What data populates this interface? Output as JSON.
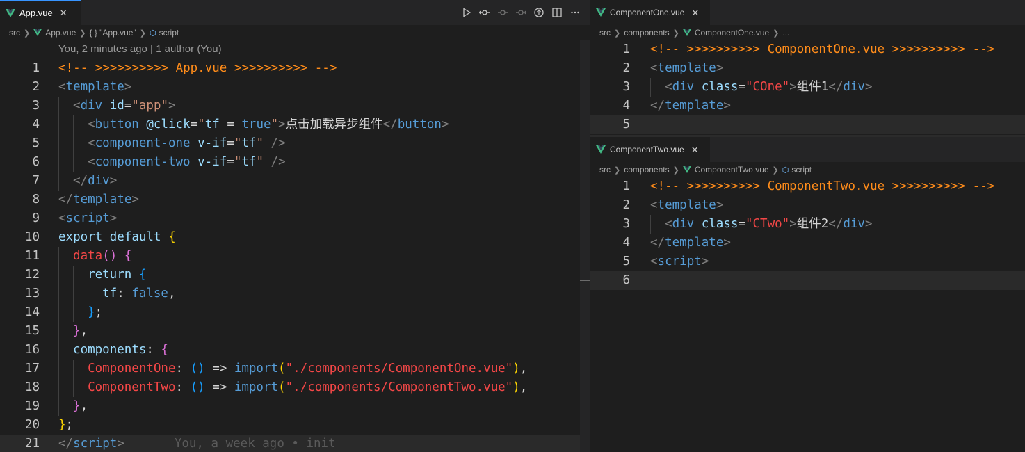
{
  "left": {
    "tab_label": "App.vue",
    "breadcrumb": [
      "src",
      "App.vue",
      "{ } \"App.vue\"",
      "script"
    ],
    "codelens": "You, 2 minutes ago | 1 author (You)",
    "blame": "You, a week ago • init",
    "line_numbers": [
      "1",
      "2",
      "3",
      "4",
      "5",
      "6",
      "7",
      "8",
      "9",
      "10",
      "11",
      "12",
      "13",
      "14",
      "15",
      "16",
      "17",
      "18",
      "19",
      "20",
      "21"
    ],
    "lines": [
      [
        "<!-- >>>>>>>>>> App.vue >>>>>>>>>> -->"
      ],
      [
        "<",
        "template",
        ">"
      ],
      [
        "<",
        "div",
        " ",
        "id",
        "=",
        "\"app\"",
        ">"
      ],
      [
        "<",
        "button",
        " ",
        "@click",
        "=",
        "\"",
        "tf",
        " = ",
        "true",
        "\"",
        ">",
        "点击加载异步组件",
        "</",
        "button",
        ">"
      ],
      [
        "<",
        "component-one",
        " ",
        "v-if",
        "=",
        "\"",
        "tf",
        "\"",
        " />"
      ],
      [
        "<",
        "component-two",
        " ",
        "v-if",
        "=",
        "\"",
        "tf",
        "\"",
        " />"
      ],
      [
        "</",
        "div",
        ">"
      ],
      [
        "</",
        "template",
        ">"
      ],
      [
        "<",
        "script",
        ">"
      ],
      [
        "export default",
        " ",
        "{"
      ],
      [
        "data",
        "()",
        " ",
        "{"
      ],
      [
        "return",
        " ",
        "{"
      ],
      [
        "tf",
        ": ",
        "false",
        ","
      ],
      [
        "}",
        ";"
      ],
      [
        "}",
        ","
      ],
      [
        "components",
        ": ",
        "{"
      ],
      [
        "ComponentOne",
        ": ",
        "()",
        " => ",
        "import",
        "(",
        "\"./components/ComponentOne.vue\"",
        ")",
        ","
      ],
      [
        "ComponentTwo",
        ": ",
        "()",
        " => ",
        "import",
        "(",
        "\"./components/ComponentTwo.vue\"",
        ")",
        ","
      ],
      [
        "}",
        ","
      ],
      [
        "}",
        ";"
      ],
      [
        "</",
        "script",
        ">"
      ]
    ]
  },
  "one": {
    "tab_label": "ComponentOne.vue",
    "breadcrumb": [
      "src",
      "components",
      "ComponentOne.vue",
      "..."
    ],
    "line_numbers": [
      "1",
      "2",
      "3",
      "4",
      "5"
    ],
    "lines": [
      [
        "<!-- >>>>>>>>>> ComponentOne.vue >>>>>>>>>> -->"
      ],
      [
        "<",
        "template",
        ">"
      ],
      [
        "<",
        "div",
        " ",
        "class",
        "=",
        "\"COne\"",
        ">",
        "组件1",
        "</",
        "div",
        ">"
      ],
      [
        "</",
        "template",
        ">"
      ],
      [
        ""
      ]
    ]
  },
  "two": {
    "tab_label": "ComponentTwo.vue",
    "breadcrumb": [
      "src",
      "components",
      "ComponentTwo.vue",
      "script"
    ],
    "line_numbers": [
      "1",
      "2",
      "3",
      "4",
      "5",
      "6"
    ],
    "lines": [
      [
        "<!-- >>>>>>>>>> ComponentTwo.vue >>>>>>>>>> -->"
      ],
      [
        "<",
        "template",
        ">"
      ],
      [
        "<",
        "div",
        " ",
        "class",
        "=",
        "\"CTwo\"",
        ">",
        "组件2",
        "</",
        "div",
        ">"
      ],
      [
        "</",
        "template",
        ">"
      ],
      [
        "<",
        "script",
        ">"
      ],
      [
        ""
      ]
    ]
  },
  "toolbar": {
    "icons": [
      "run-icon",
      "source-control-icon",
      "previous-change-icon",
      "next-change-icon",
      "open-changes-icon",
      "split-editor-icon",
      "more-actions-icon"
    ]
  },
  "colors": {
    "background": "#1e1e1e",
    "tab_bar": "#252526",
    "comment": "#ff8c1a",
    "tag": "#569cd6",
    "attribute": "#9cdcfe",
    "string": "#ce9178",
    "bracket_gold": "#ffd700",
    "bracket_pink": "#da70d6",
    "bracket_blue": "#179fff",
    "vue_green": "#41b883"
  }
}
